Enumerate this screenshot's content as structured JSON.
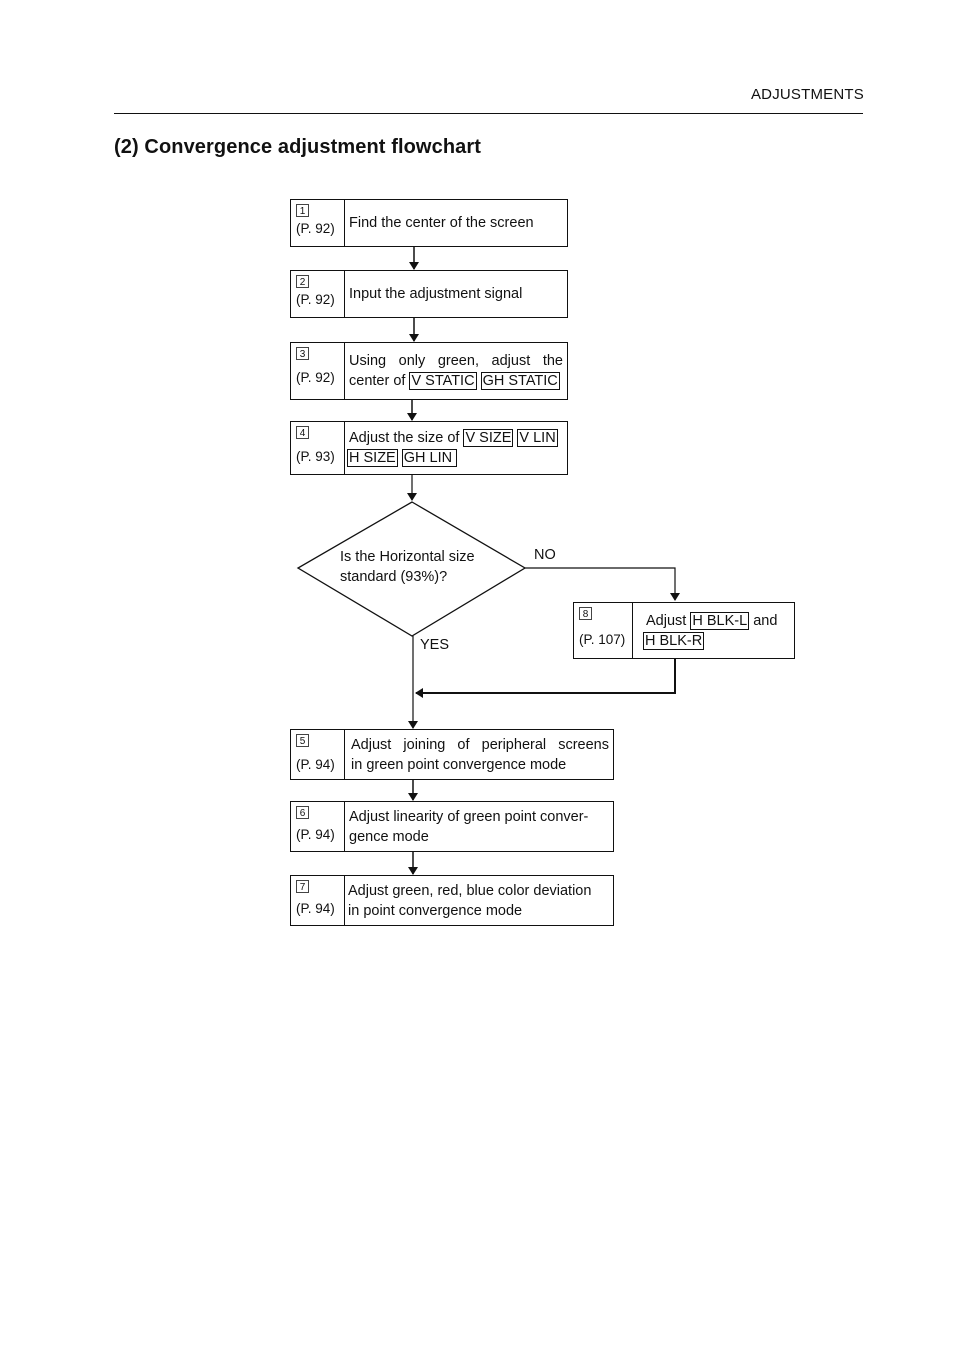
{
  "header": {
    "section_label": "ADJUSTMENTS"
  },
  "title": "(2) Convergence adjustment flowchart",
  "steps": {
    "s1": {
      "num": "1",
      "page": "(P. 92)",
      "text": "Find the center of the screen"
    },
    "s2": {
      "num": "2",
      "page": "(P. 92)",
      "text": "Input the adjustment signal"
    },
    "s3": {
      "num": "3",
      "page": "(P. 92)",
      "line1": "Using only green, adjust the",
      "prefix": "center of",
      "tags": [
        "V STATIC",
        "GH STATIC"
      ]
    },
    "s4": {
      "num": "4",
      "page": "(P. 93)",
      "prefix": "Adjust the size of",
      "tags": [
        "V SIZE",
        "V LIN",
        "H SIZE",
        "GH LIN"
      ]
    },
    "s5": {
      "num": "5",
      "page": "(P. 94)",
      "line1": "Adjust joining of peripheral screens",
      "line2": "in green point convergence mode"
    },
    "s6": {
      "num": "6",
      "page": "(P. 94)",
      "line1": "Adjust linearity of green point conver-",
      "line2": "gence mode"
    },
    "s7": {
      "num": "7",
      "page": "(P. 94)",
      "line1": "Adjust green, red, blue color deviation",
      "line2": "in point convergence mode"
    },
    "s8": {
      "num": "8",
      "page": "(P. 107)",
      "prefix": "Adjust",
      "tags": [
        "H BLK-L",
        "H BLK-R"
      ],
      "connector": "and"
    }
  },
  "decision": {
    "line1": "Is the Horizontal size",
    "line2": "standard (93%)?",
    "no_label": "NO",
    "yes_label": "YES"
  }
}
